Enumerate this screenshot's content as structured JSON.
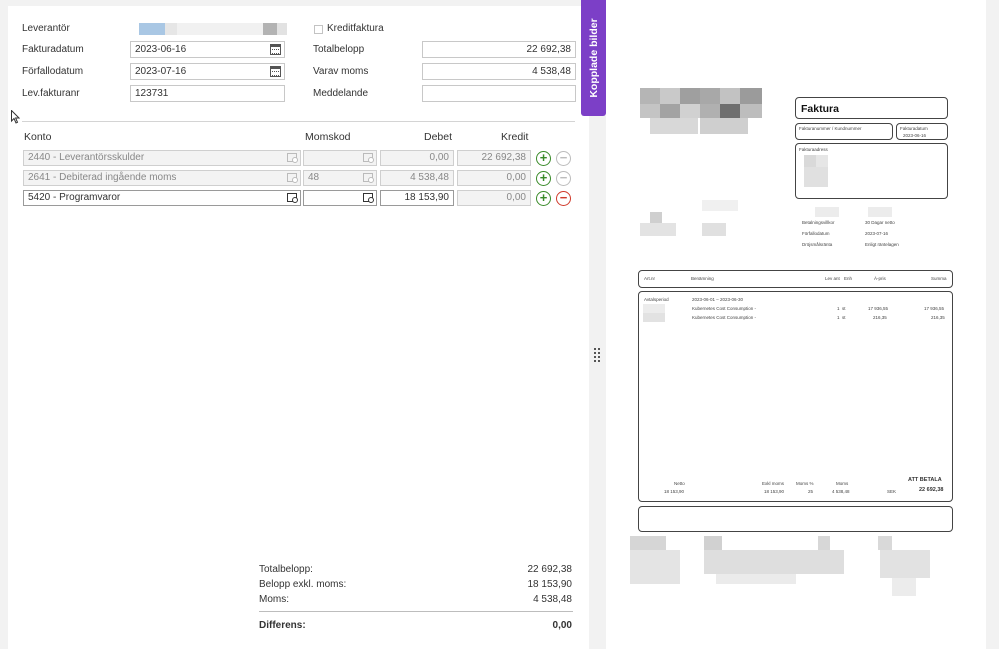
{
  "form": {
    "supplier_label": "Leverantör",
    "credit_invoice_label": "Kreditfaktura",
    "invoice_date_label": "Fakturadatum",
    "invoice_date": "2023-06-16",
    "total_label": "Totalbelopp",
    "total_value": "22 692,38",
    "due_date_label": "Förfallodatum",
    "due_date": "2023-07-16",
    "vat_label": "Varav moms",
    "vat_value": "4 538,48",
    "invoice_no_label": "Lev.fakturanr",
    "invoice_no": "123731",
    "message_label": "Meddelande",
    "message_value": ""
  },
  "table": {
    "headers": {
      "account": "Konto",
      "vat_code": "Momskod",
      "debit": "Debet",
      "credit": "Kredit"
    },
    "rows": [
      {
        "account": "2440 - Leverantörsskulder",
        "vat_code": "",
        "debit": "0,00",
        "credit": "22 692,38"
      },
      {
        "account": "2641 - Debiterad ingående moms",
        "vat_code": "48",
        "debit": "4 538,48",
        "credit": "0,00"
      },
      {
        "account": "5420 - Programvaror",
        "vat_code": "",
        "debit": "18 153,90",
        "credit": "0,00"
      }
    ]
  },
  "summary": {
    "total_label": "Totalbelopp:",
    "total_value": "22 692,38",
    "excl_vat_label": "Belopp exkl. moms:",
    "excl_vat_value": "18 153,90",
    "vat_label": "Moms:",
    "vat_value": "4 538,48",
    "diff_label": "Differens:",
    "diff_value": "0,00"
  },
  "side_tab": {
    "label": "Kopplade bilder"
  },
  "invoice_doc": {
    "title": "Faktura",
    "invoice_number_label": "Fakturanummer / Kundnummer",
    "invoice_date_label": "Fakturadatum",
    "invoice_date": "2023-06-16",
    "address_label": "Fakturaadress",
    "terms": [
      {
        "label": "Betalningsvillkor",
        "value": "30 Dagar netto"
      },
      {
        "label": "Förfallodatum",
        "value": "2023-07-16"
      },
      {
        "label": "Dröjsmålsränta",
        "value": "Enligt räntelagen"
      }
    ],
    "columns": {
      "art": "Art.nr",
      "desc": "Benämning",
      "qty": "Lev ant",
      "unit": "Enh",
      "price": "À-pris",
      "sum": "Summa"
    },
    "period_label": "Avtalsperiod",
    "period": "2023-06-01 – 2023-06-30",
    "lines": [
      {
        "desc": "Kubernetes Cost Consumption -",
        "qty": "1",
        "unit": "st",
        "price": "17 936,55",
        "sum": "17 936,55"
      },
      {
        "desc": "Kubernetes Cost Consumption -",
        "qty": "1",
        "unit": "st",
        "price": "216,35",
        "sum": "216,35"
      }
    ],
    "footer": {
      "net_label": "Netto",
      "net": "18 153,90",
      "excl_label": "Exkl moms",
      "excl": "18 153,90",
      "vat_pct_label": "Moms %",
      "vat_pct": "25",
      "vat_label": "Moms",
      "vat": "4 538,48",
      "currency": "SEK",
      "pay_label": "ATT BETALA",
      "pay": "22 692,38"
    }
  },
  "colors": {
    "accent": "#7c3fc7",
    "plus": "#3a8b2a",
    "minus": "#d03a2b"
  }
}
